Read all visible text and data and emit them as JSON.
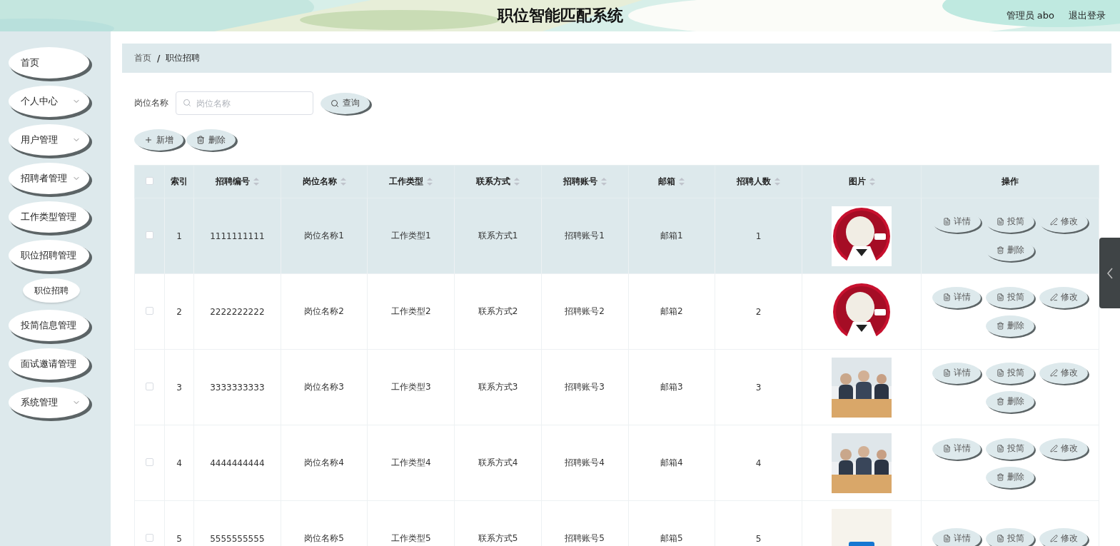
{
  "header": {
    "title": "职位智能匹配系统",
    "user": "管理员 abo",
    "logout": "退出登录"
  },
  "sidebar": {
    "items": [
      {
        "label": "首页",
        "expandable": false
      },
      {
        "label": "个人中心",
        "expandable": true
      },
      {
        "label": "用户管理",
        "expandable": true
      },
      {
        "label": "招聘者管理",
        "expandable": true
      },
      {
        "label": "工作类型管理",
        "expandable": false
      },
      {
        "label": "职位招聘管理",
        "expandable": false,
        "children": [
          {
            "label": "职位招聘",
            "selected": true
          }
        ]
      },
      {
        "label": "投简信息管理",
        "expandable": false
      },
      {
        "label": "面试邀请管理",
        "expandable": false
      },
      {
        "label": "系统管理",
        "expandable": true
      }
    ]
  },
  "breadcrumb": {
    "separator": "/",
    "items": [
      "首页",
      "职位招聘"
    ]
  },
  "search": {
    "label": "岗位名称",
    "placeholder": "岗位名称",
    "button": "查询"
  },
  "toolbar": [
    {
      "kind": "add",
      "label": "新增"
    },
    {
      "kind": "delete",
      "label": "删除"
    }
  ],
  "table": {
    "select_all": false,
    "columns": [
      {
        "label": "索引",
        "sortable": false
      },
      {
        "label": "招聘编号",
        "sortable": true
      },
      {
        "label": "岗位名称",
        "sortable": true
      },
      {
        "label": "工作类型",
        "sortable": true
      },
      {
        "label": "联系方式",
        "sortable": true
      },
      {
        "label": "招聘账号",
        "sortable": true
      },
      {
        "label": "邮箱",
        "sortable": true
      },
      {
        "label": "招聘人数",
        "sortable": true
      },
      {
        "label": "图片",
        "sortable": true
      },
      {
        "label": "操作",
        "sortable": false
      }
    ],
    "rows": [
      {
        "selected": true,
        "checked": false,
        "cells": [
          "1",
          "1111111111",
          "岗位名称1",
          "工作类型1",
          "联系方式1",
          "招聘账号1",
          "邮箱1",
          "1"
        ],
        "picture": {
          "kind": "picture"
        },
        "actions": [
          {
            "kind": "detail",
            "label": "详情"
          },
          {
            "kind": "resume",
            "label": "投简"
          },
          {
            "kind": "edit",
            "label": "修改"
          },
          {
            "kind": "delete",
            "label": "删除"
          }
        ]
      },
      {
        "selected": false,
        "checked": false,
        "cells": [
          "2",
          "2222222222",
          "岗位名称2",
          "工作类型2",
          "联系方式2",
          "招聘账号2",
          "邮箱2",
          "2"
        ],
        "picture": {
          "kind": "picture"
        },
        "actions": [
          {
            "kind": "detail",
            "label": "详情"
          },
          {
            "kind": "resume",
            "label": "投简"
          },
          {
            "kind": "edit",
            "label": "修改"
          },
          {
            "kind": "delete",
            "label": "删除"
          }
        ]
      },
      {
        "selected": false,
        "checked": false,
        "cells": [
          "3",
          "3333333333",
          "岗位名称3",
          "工作类型3",
          "联系方式3",
          "招聘账号3",
          "邮箱3",
          "3"
        ],
        "picture": {
          "kind": "picture"
        },
        "actions": [
          {
            "kind": "detail",
            "label": "详情"
          },
          {
            "kind": "resume",
            "label": "投简"
          },
          {
            "kind": "edit",
            "label": "修改"
          },
          {
            "kind": "delete",
            "label": "删除"
          }
        ]
      },
      {
        "selected": false,
        "checked": false,
        "cells": [
          "4",
          "4444444444",
          "岗位名称4",
          "工作类型4",
          "联系方式4",
          "招聘账号4",
          "邮箱4",
          "4"
        ],
        "picture": {
          "kind": "picture"
        },
        "actions": [
          {
            "kind": "detail",
            "label": "详情"
          },
          {
            "kind": "resume",
            "label": "投简"
          },
          {
            "kind": "edit",
            "label": "修改"
          },
          {
            "kind": "delete",
            "label": "删除"
          }
        ]
      },
      {
        "selected": false,
        "checked": false,
        "cells": [
          "5",
          "5555555555",
          "岗位名称5",
          "工作类型5",
          "联系方式5",
          "招聘账号5",
          "邮箱5",
          "5"
        ],
        "picture": {
          "kind": "picture"
        },
        "actions": [
          {
            "kind": "detail",
            "label": "详情"
          },
          {
            "kind": "resume",
            "label": "投简"
          },
          {
            "kind": "edit",
            "label": "修改"
          }
        ]
      }
    ]
  }
}
